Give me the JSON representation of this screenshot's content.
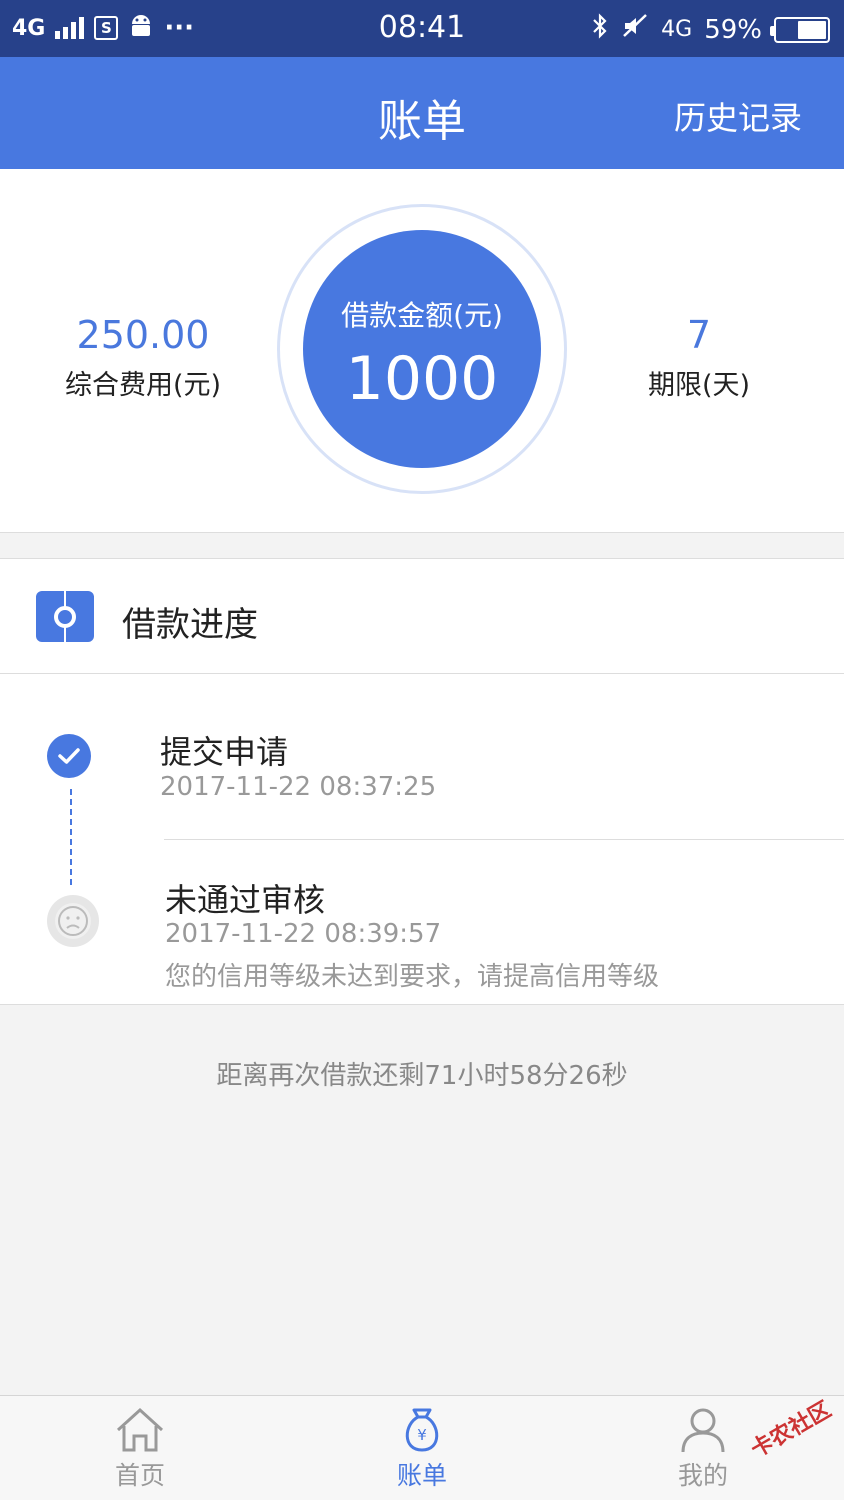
{
  "status_bar": {
    "network_left": "4G",
    "sim_icon_label": "S",
    "more": "···",
    "time": "08:41",
    "network_right": "4G",
    "battery": "59%",
    "battery_level": 0.59
  },
  "nav": {
    "title": "账单",
    "history": "历史记录"
  },
  "summary": {
    "fee_value": "250.00",
    "fee_label": "综合费用(元)",
    "amount_label": "借款金额(元)",
    "amount_value": "1000",
    "term_value": "7",
    "term_label": "期限(天)"
  },
  "progress": {
    "title": "借款进度",
    "steps": [
      {
        "title": "提交申请",
        "time": "2017-11-22 08:37:25",
        "status": "done"
      },
      {
        "title": "未通过审核",
        "time": "2017-11-22 08:39:57",
        "note": "您的信用等级未达到要求，请提高信用等级",
        "status": "failed"
      }
    ]
  },
  "countdown": "距离再次借款还剩71小时58分26秒",
  "tabs": [
    {
      "label": "首页",
      "icon": "home-icon"
    },
    {
      "label": "账单",
      "icon": "money-bag-icon",
      "active": true
    },
    {
      "label": "我的",
      "icon": "user-icon"
    }
  ],
  "watermark": "卡农社区",
  "colors": {
    "primary": "#4878e0",
    "status_bar": "#27418a",
    "muted": "#999999"
  }
}
